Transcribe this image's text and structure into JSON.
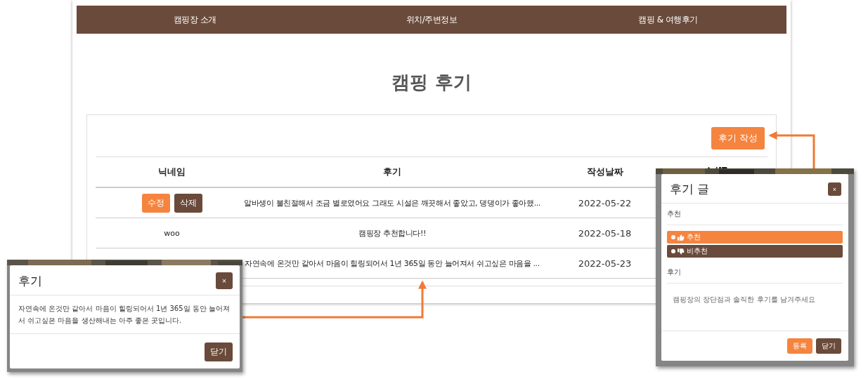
{
  "nav": {
    "items": [
      {
        "label": "캠핑장 소개"
      },
      {
        "label": "위치/주변정보"
      },
      {
        "label": "캠핑 & 여행후기"
      }
    ]
  },
  "page_title": "캠핑 후기",
  "write_button": "후기 작성",
  "table": {
    "columns": [
      "닉네임",
      "후기",
      "작성날짜"
    ],
    "rows": [
      {
        "actions": [
          "수정",
          "삭제"
        ],
        "review": "알바생이 불친절해서 조금 별로였어요 그래도 시설은 깨끗해서 좋았고, 댕댕이가 좋아했...",
        "date": "2022-05-22"
      },
      {
        "nickname": "woo",
        "review": "캠핑장 추천합니다!!",
        "date": "2022-05-18"
      },
      {
        "review": "자연속에 온것만 같아서 마음이 힐링되어서 1년 365일 동안 늘어져서 쉬고싶은 마음을 ...",
        "date": "2022-05-23"
      }
    ]
  },
  "view_modal": {
    "title": "후기",
    "close_icon": "×",
    "body": "자연속에 온것만 같아서 마음이 힐링되어서 1년 365일 동안 늘어져서 쉬고싶은 마음을 생산해내는 아주 좋은 곳입니다.",
    "close_button": "닫기"
  },
  "write_modal": {
    "title": "후기 글",
    "close_icon": "×",
    "recommend_label": "추천",
    "options": [
      {
        "label": "추천",
        "kind": "up",
        "color": "#f5843f"
      },
      {
        "label": "비추천",
        "kind": "down",
        "color": "#6a4a3a"
      }
    ],
    "review_label": "후기",
    "placeholder": "캠핑장의 장단점과 솔직한 후기를 남겨주세요",
    "submit_button": "등록",
    "close_button": "닫기"
  }
}
